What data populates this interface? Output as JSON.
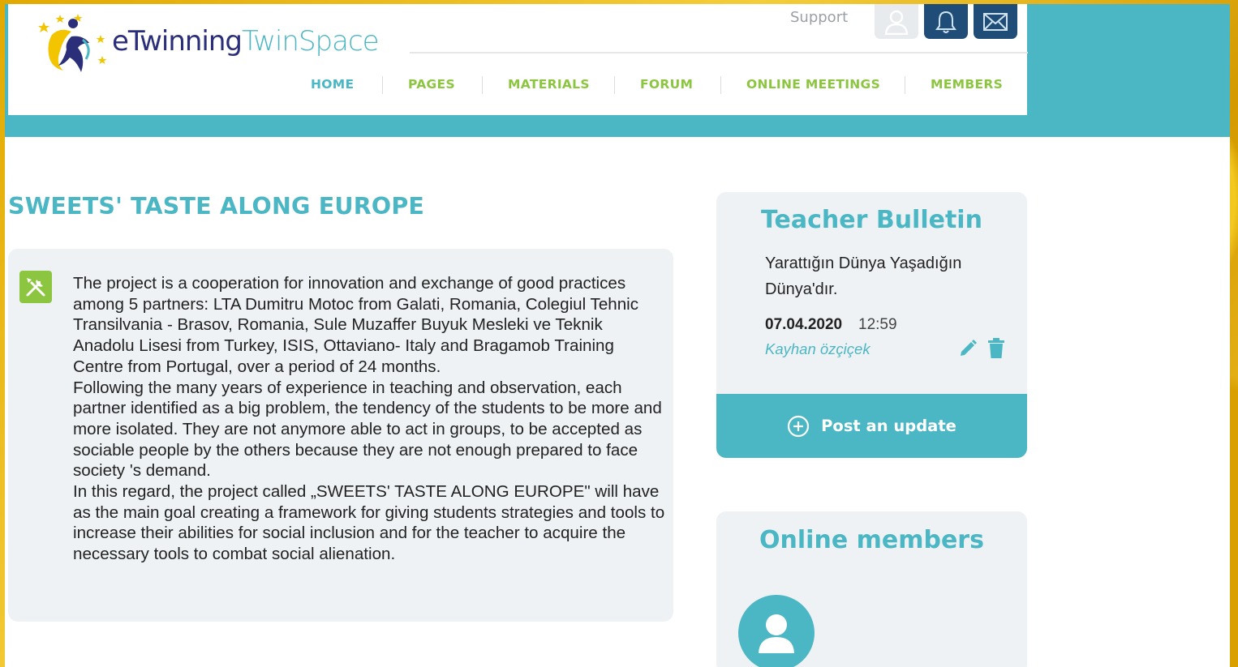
{
  "header": {
    "logo_prefix": "e",
    "logo_twinning": "Twinning",
    "logo_twinspace": "TwinSpace",
    "support_label": "Support",
    "icons": {
      "user": "user-icon",
      "bell": "bell-icon",
      "mail": "mail-icon"
    }
  },
  "nav": {
    "items": [
      {
        "label": "HOME",
        "active": true
      },
      {
        "label": "PAGES"
      },
      {
        "label": "MATERIALS"
      },
      {
        "label": "FORUM"
      },
      {
        "label": "ONLINE MEETINGS"
      },
      {
        "label": "MEMBERS"
      }
    ]
  },
  "main": {
    "title": "SWEETS' TASTE ALONG EUROPE",
    "description": [
      "The project is a cooperation for innovation and exchange of good practices among 5 partners: LTA Dumitru Motoc from Galati, Romania, Colegiul Tehnic Transilvania - Brasov, Romania, Sule Muzaffer Buyuk Mesleki ve Teknik",
      "Anadolu Lisesi from Turkey, ISIS, Ottaviano- Italy and Bragamob Training Centre from Portugal, over a period of 24 months.",
      "Following the many years of experience in teaching and observation, each partner identified as a big problem, the tendency of the students to be more and more isolated. They are not anymore able to act in groups, to be accepted as sociable people by the others because they are not enough prepared to face society 's demand.",
      "In this regard, the project called „SWEETS' TASTE ALONG EUROPE\" will have as the main goal creating a framework for giving students strategies and tools to increase their abilities for social inclusion and for the teacher to acquire the necessary tools to combat social alienation."
    ]
  },
  "bulletin": {
    "title": "Teacher Bulletin",
    "message": "Yarattığın Dünya Yaşadığın Dünya'dır.",
    "date": "07.04.2020",
    "time": "12:59",
    "author": "Kayhan özçiçek",
    "post_label": "Post an update"
  },
  "online": {
    "title": "Online members"
  },
  "colors": {
    "teal": "#4bb6c4",
    "green": "#8cc53f",
    "navy": "#1f4d77",
    "card": "#eef2f5"
  }
}
